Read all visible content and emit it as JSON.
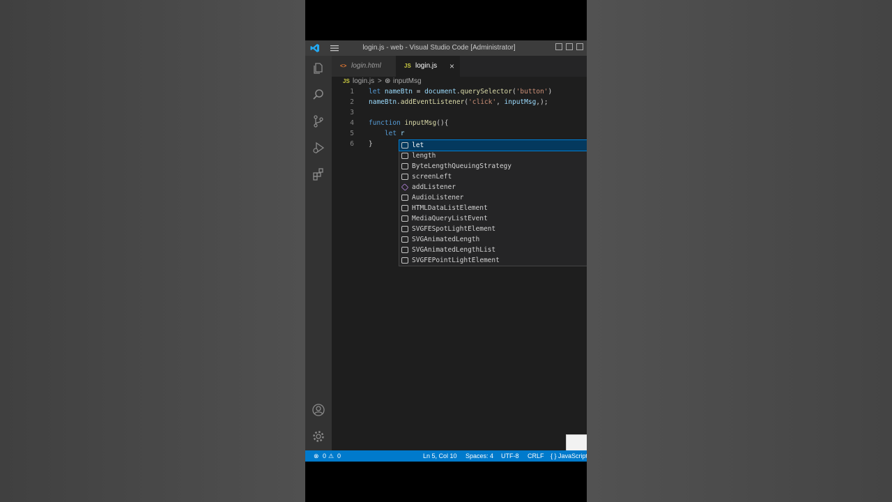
{
  "window": {
    "title": "login.js - web - Visual Studio Code [Administrator]"
  },
  "tabs": [
    {
      "label": "login.html",
      "icon": "<>",
      "active": false
    },
    {
      "label": "login.js",
      "icon": "JS",
      "active": true,
      "close": "×"
    }
  ],
  "breadcrumb": {
    "file_icon": "JS",
    "file": "login.js",
    "separator": ">",
    "symbol": "inputMsg"
  },
  "editor": {
    "line_numbers": [
      "1",
      "2",
      "3",
      "4",
      "5",
      "6"
    ],
    "lines": [
      [
        {
          "t": "let ",
          "c": "kw"
        },
        {
          "t": "nameBtn",
          "c": "vr"
        },
        {
          "t": " = ",
          "c": "pn"
        },
        {
          "t": "document",
          "c": "vr"
        },
        {
          "t": ".",
          "c": "pn"
        },
        {
          "t": "querySelector",
          "c": "fn"
        },
        {
          "t": "(",
          "c": "pn"
        },
        {
          "t": "'button'",
          "c": "st"
        },
        {
          "t": ")",
          "c": "pn"
        }
      ],
      [
        {
          "t": "nameBtn",
          "c": "vr"
        },
        {
          "t": ".",
          "c": "pn"
        },
        {
          "t": "addEventListener",
          "c": "fn"
        },
        {
          "t": "(",
          "c": "pn"
        },
        {
          "t": "'click'",
          "c": "st"
        },
        {
          "t": ", ",
          "c": "pn"
        },
        {
          "t": "inputMsg",
          "c": "vr"
        },
        {
          "t": ",);",
          "c": "pn"
        }
      ],
      [],
      [
        {
          "t": "function ",
          "c": "kw"
        },
        {
          "t": "inputMsg",
          "c": "fn"
        },
        {
          "t": "(){",
          "c": "pn"
        }
      ],
      [
        {
          "t": "    let ",
          "c": "kw"
        },
        {
          "t": "r",
          "c": "vr"
        }
      ],
      [
        {
          "t": "}",
          "c": "pn"
        }
      ]
    ]
  },
  "suggestions": [
    {
      "label": "let",
      "kind": "keyword",
      "selected": true
    },
    {
      "label": "length",
      "kind": "variable"
    },
    {
      "label": "ByteLengthQueuingStrategy",
      "kind": "variable"
    },
    {
      "label": "screenLeft",
      "kind": "variable"
    },
    {
      "label": "addListener",
      "kind": "method"
    },
    {
      "label": "AudioListener",
      "kind": "variable"
    },
    {
      "label": "HTMLDataListElement",
      "kind": "variable"
    },
    {
      "label": "MediaQueryListEvent",
      "kind": "variable"
    },
    {
      "label": "SVGFESpotLightElement",
      "kind": "variable"
    },
    {
      "label": "SVGAnimatedLength",
      "kind": "variable"
    },
    {
      "label": "SVGAnimatedLengthList",
      "kind": "variable"
    },
    {
      "label": "SVGFEPointLightElement",
      "kind": "variable"
    }
  ],
  "statusbar": {
    "errors": "0",
    "warnings": "0",
    "position": "Ln 5, Col 10",
    "spaces": "Spaces: 4",
    "encoding": "UTF-8",
    "eol": "CRLF",
    "language": "{ } JavaScript"
  },
  "colors": {
    "statusbar": "#007acc",
    "editor_bg": "#1e1e1e",
    "activity_bg": "#333333",
    "selection": "#04395e"
  }
}
